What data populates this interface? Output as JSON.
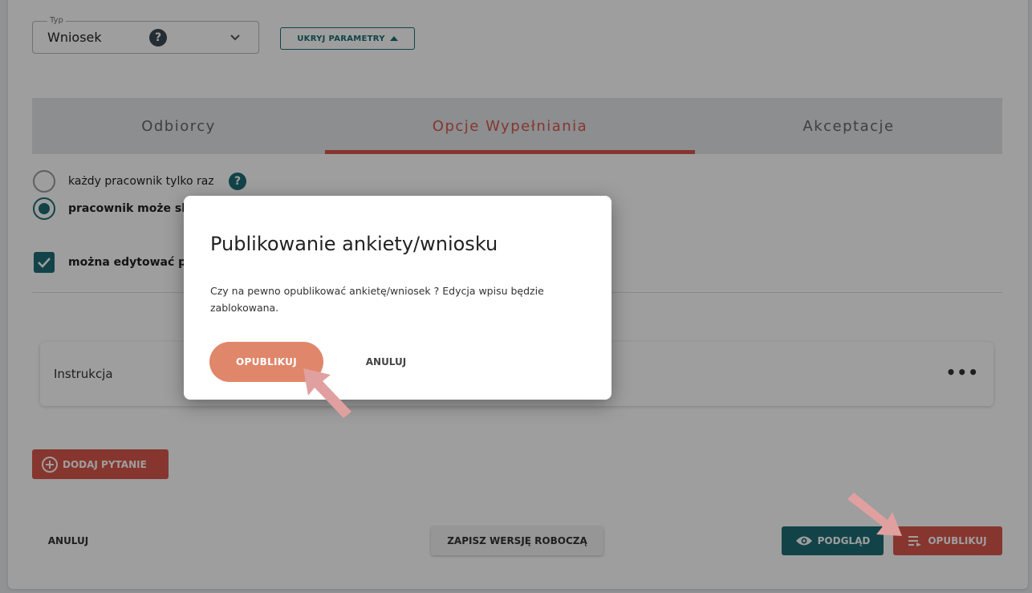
{
  "type_select": {
    "legend": "Typ",
    "value": "Wniosek",
    "help": "?"
  },
  "hide_params_label": "UKRYJ PARAMETRY",
  "tabs": [
    {
      "label": "Odbiorcy"
    },
    {
      "label": "Opcje Wypełniania"
    },
    {
      "label": "Akceptacje"
    }
  ],
  "options": {
    "radio1": "każdy pracownik tylko raz",
    "radio1_help": "?",
    "radio2": "pracownik może skł",
    "checkbox": "można edytować po"
  },
  "instruction": {
    "label": "Instrukcja",
    "menu": "•••"
  },
  "add_question_label": "DODAJ PYTANIE",
  "bottom": {
    "cancel": "ANULUJ",
    "draft": "ZAPISZ WERSJĘ ROBOCZĄ",
    "preview": "PODGLĄD",
    "publish": "OPUBLIKUJ"
  },
  "dialog": {
    "title": "Publikowanie ankiety/wniosku",
    "message": "Czy na pewno opublikować ankietę/wniosek ? Edycja wpisu będzie zablokowana.",
    "confirm": "OPUBLIKUJ",
    "cancel": "ANULUJ"
  },
  "colors": {
    "accent": "#d9574b",
    "teal": "#1e6c74",
    "dialog_button": "#e0866a",
    "annotation_arrow": "#e0a0a0"
  }
}
